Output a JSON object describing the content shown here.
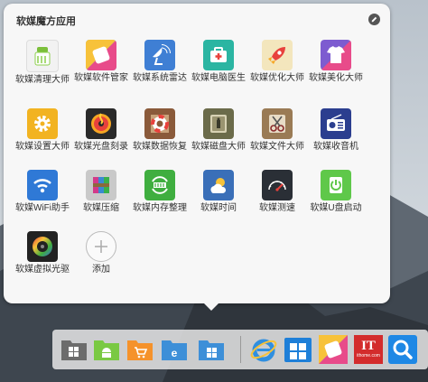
{
  "panel": {
    "title": "软媒魔方应用",
    "apps": [
      {
        "label": "软媒清理大师",
        "icon": "broom-icon",
        "color": "#f0f0f0"
      },
      {
        "label": "软媒软件管家",
        "icon": "tiles-icon",
        "color": "#e84b8a"
      },
      {
        "label": "软媒系统雷达",
        "icon": "radar-dish-icon",
        "color": "#3f7fd4"
      },
      {
        "label": "软媒电脑医生",
        "icon": "medkit-icon",
        "color": "#2bb5a2"
      },
      {
        "label": "软媒优化大师",
        "icon": "rocket-icon",
        "color": "#f3e6bd"
      },
      {
        "label": "软媒美化大师",
        "icon": "tshirt-icon",
        "color": "#7d5cd0"
      },
      {
        "label": "软媒设置大师",
        "icon": "gear-icon",
        "color": "#f2b321"
      },
      {
        "label": "软媒光盘刻录",
        "icon": "disc-icon",
        "color": "#2a2a2a"
      },
      {
        "label": "软媒数据恢复",
        "icon": "lifebuoy-icon",
        "color": "#8a5a3a"
      },
      {
        "label": "软媒磁盘大师",
        "icon": "safe-icon",
        "color": "#6b6b4a"
      },
      {
        "label": "软媒文件大师",
        "icon": "scissors-icon",
        "color": "#9a7b55"
      },
      {
        "label": "软媒收音机",
        "icon": "radio-icon",
        "color": "#2b3e8f"
      },
      {
        "label": "软媒WiFi助手",
        "icon": "wifi-icon",
        "color": "#2f79d6"
      },
      {
        "label": "软媒压缩",
        "icon": "books-icon",
        "color": "#b5b5b5"
      },
      {
        "label": "软媒内存整理",
        "icon": "memory-icon",
        "color": "#3fae3f"
      },
      {
        "label": "软媒时间",
        "icon": "weather-icon",
        "color": "#3a6fb8"
      },
      {
        "label": "软媒测速",
        "icon": "gauge-icon",
        "color": "#2a2f36"
      },
      {
        "label": "软媒U盘启动",
        "icon": "usb-power-icon",
        "color": "#5fc84a"
      },
      {
        "label": "软媒虚拟光驱",
        "icon": "virtual-disc-icon",
        "color": "#222222"
      },
      {
        "label": "添加",
        "icon": "plus-icon",
        "color": "#ffffff"
      }
    ]
  },
  "dock": {
    "items": [
      {
        "name": "windows-folder-icon",
        "color": "#6c6c6c"
      },
      {
        "name": "android-folder-icon",
        "color": "#7ac943"
      },
      {
        "name": "shopping-cart-folder-icon",
        "color": "#f5922b"
      },
      {
        "name": "ie-folder-icon",
        "color": "#3d8fd8"
      },
      {
        "name": "store-folder-icon",
        "color": "#3d8fd8"
      },
      {
        "name": "internet-explorer-icon",
        "color": "#2f8fe0"
      },
      {
        "name": "windows-store-icon",
        "color": "#1e7fd8"
      },
      {
        "name": "software-manager-icon",
        "color": "#e84b8a"
      },
      {
        "name": "ithome-icon",
        "color": "#d32c2c"
      },
      {
        "name": "search-icon",
        "color": "#1e88e5"
      }
    ],
    "ithome_caption": "ithome.com",
    "ithome_mark": "IT"
  }
}
